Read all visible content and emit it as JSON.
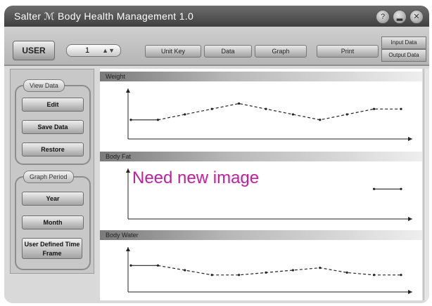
{
  "window": {
    "title": "Salter ℳ Body Health Management 1.0",
    "controls": {
      "help_glyph": "?",
      "minimize_glyph": "▂",
      "close_glyph": "✕"
    }
  },
  "toolbar": {
    "user_label": "USER",
    "user_number": "1",
    "user_stepper_glyph": "▲▼",
    "tabs": [
      "Unit Key",
      "Data",
      "Graph",
      "Print"
    ],
    "right_buttons": [
      "Input Data",
      "Output Data"
    ]
  },
  "sidebar": {
    "view_group": {
      "caption": "View Data",
      "buttons": [
        "Edit",
        "Save Data",
        "Restore"
      ]
    },
    "graph_group": {
      "caption": "Graph Period",
      "buttons": [
        "Year",
        "Month",
        "User Defined Time Frame"
      ]
    }
  },
  "charts": [
    {
      "header": "Weight"
    },
    {
      "header": "Body Fat"
    },
    {
      "header": "Body Water"
    }
  ],
  "overlay_text": "Need new image",
  "chart_data": [
    {
      "type": "line",
      "title": "Weight",
      "x": [
        0,
        1,
        2,
        3,
        4,
        5,
        6,
        7,
        8,
        9,
        10
      ],
      "y": [
        3,
        3,
        4,
        5,
        6,
        5,
        4,
        3,
        4,
        5,
        5
      ]
    },
    {
      "type": "line",
      "title": "Body Fat",
      "x": [
        9,
        10
      ],
      "y": [
        5,
        5
      ]
    },
    {
      "type": "line",
      "title": "Body Water",
      "x": [
        0,
        1,
        2,
        3,
        4,
        5,
        6,
        7,
        8,
        9,
        10
      ],
      "y": [
        5,
        5,
        4,
        3,
        3,
        3.5,
        4,
        4.5,
        3.5,
        3,
        3
      ]
    }
  ],
  "colors": {
    "overlay": "#c020a0"
  }
}
